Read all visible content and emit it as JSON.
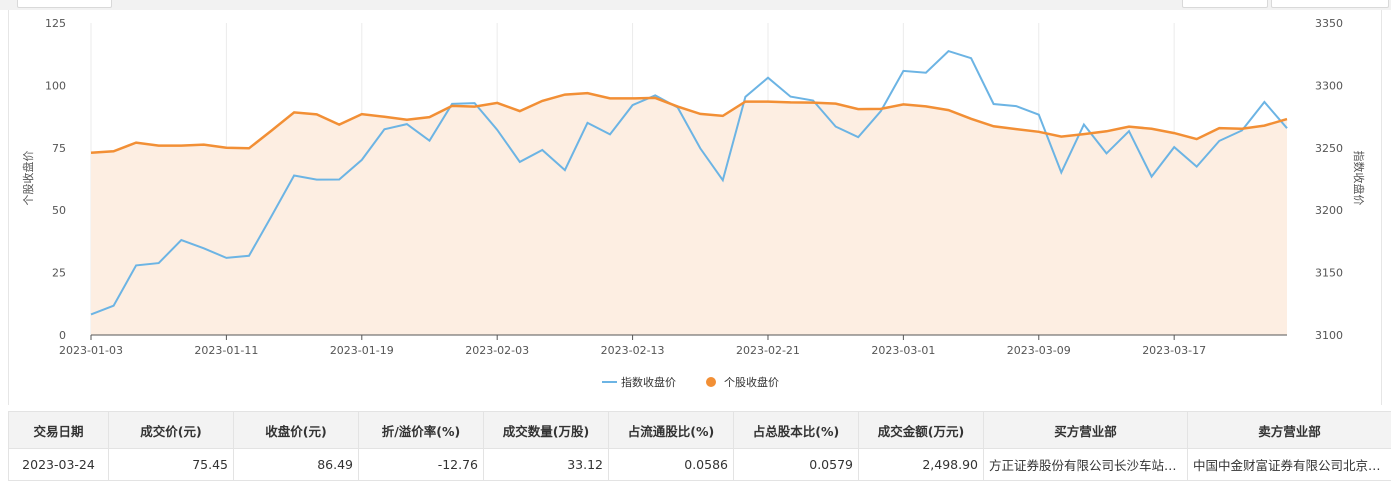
{
  "chart_data": {
    "type": "line",
    "x": [
      "2023-01-03",
      "2023-01-04",
      "2023-01-05",
      "2023-01-06",
      "2023-01-09",
      "2023-01-10",
      "2023-01-11",
      "2023-01-12",
      "2023-01-13",
      "2023-01-16",
      "2023-01-17",
      "2023-01-18",
      "2023-01-19",
      "2023-01-20",
      "2023-01-30",
      "2023-01-31",
      "2023-02-01",
      "2023-02-02",
      "2023-02-03",
      "2023-02-06",
      "2023-02-07",
      "2023-02-08",
      "2023-02-09",
      "2023-02-10",
      "2023-02-13",
      "2023-02-14",
      "2023-02-15",
      "2023-02-16",
      "2023-02-17",
      "2023-02-20",
      "2023-02-21",
      "2023-02-22",
      "2023-02-23",
      "2023-02-24",
      "2023-02-27",
      "2023-02-28",
      "2023-03-01",
      "2023-03-02",
      "2023-03-03",
      "2023-03-06",
      "2023-03-07",
      "2023-03-08",
      "2023-03-09",
      "2023-03-10",
      "2023-03-13",
      "2023-03-14",
      "2023-03-15",
      "2023-03-16",
      "2023-03-17",
      "2023-03-20",
      "2023-03-21",
      "2023-03-22",
      "2023-03-23",
      "2023-03-24"
    ],
    "x_ticks": [
      "2023-01-03",
      "2023-01-11",
      "2023-01-19",
      "2023-02-03",
      "2023-02-13",
      "2023-02-21",
      "2023-03-01",
      "2023-03-09",
      "2023-03-17"
    ],
    "y_left": {
      "label": "个股收盘价",
      "range": [
        0,
        125
      ],
      "ticks": [
        "0",
        "25",
        "50",
        "75",
        "100",
        "125"
      ]
    },
    "y_right": {
      "label": "指数收盘价",
      "range": [
        3100,
        3350
      ],
      "ticks": [
        "3100",
        "3150",
        "3200",
        "3250",
        "3300",
        "3350"
      ]
    },
    "series": [
      {
        "name": "指数收盘价",
        "axis": "right",
        "color": "#6cb4e4",
        "values": [
          3116.5,
          3123.5,
          3155.8,
          3157.6,
          3176.1,
          3169.5,
          3161.8,
          3163.5,
          3195.3,
          3227.8,
          3224.5,
          3224.6,
          3240.3,
          3264.8,
          3269.0,
          3255.7,
          3285.2,
          3285.8,
          3264.4,
          3238.7,
          3248.2,
          3232.1,
          3270.0,
          3260.7,
          3284.2,
          3292.0,
          3282.3,
          3249.5,
          3224.0,
          3290.9,
          3306.2,
          3291.0,
          3287.9,
          3267.0,
          3258.5,
          3279.3,
          3311.6,
          3310.2,
          3327.5,
          3321.8,
          3285.1,
          3283.4,
          3276.5,
          3230.2,
          3268.7,
          3245.5,
          3263.3,
          3226.9,
          3250.6,
          3234.9,
          3255.5,
          3263.9,
          3286.7,
          3265.7
        ]
      },
      {
        "name": "个股收盘价",
        "axis": "left",
        "color": "#f28f35",
        "values": [
          73.0,
          73.6,
          77.1,
          75.9,
          75.9,
          76.3,
          75.0,
          74.8,
          81.9,
          89.2,
          88.4,
          84.3,
          88.5,
          87.4,
          86.2,
          87.3,
          91.8,
          91.5,
          93.0,
          89.7,
          93.8,
          96.3,
          96.9,
          94.8,
          94.8,
          95.0,
          91.5,
          88.6,
          87.8,
          93.5,
          93.5,
          93.2,
          93.1,
          92.7,
          90.5,
          90.6,
          92.4,
          91.6,
          90.1,
          86.6,
          83.6,
          82.5,
          81.4,
          79.5,
          80.5,
          81.6,
          83.5,
          82.6,
          80.9,
          78.5,
          82.9,
          82.6,
          83.9,
          86.49
        ]
      }
    ],
    "area_under": "个股收盘价",
    "legend_position": "bottom-center",
    "grid": "vertical"
  },
  "legend": {
    "index_label": "指数收盘价",
    "stock_label": "个股收盘价"
  },
  "table": {
    "headers": [
      "交易日期",
      "成交价(元)",
      "收盘价(元)",
      "折/溢价率(%)",
      "成交数量(万股)",
      "占流通股比(%)",
      "占总股本比(%)",
      "成交金额(万元)",
      "买方营业部",
      "卖方营业部"
    ],
    "rows": [
      [
        "2023-03-24",
        "75.45",
        "86.49",
        "-12.76",
        "33.12",
        "0.0586",
        "0.0579",
        "2,498.90",
        "方正证券股份有限公司长沙车站北路证券营业部",
        "中国中金财富证券有限公司北京宋庄路证券营业部"
      ]
    ]
  }
}
